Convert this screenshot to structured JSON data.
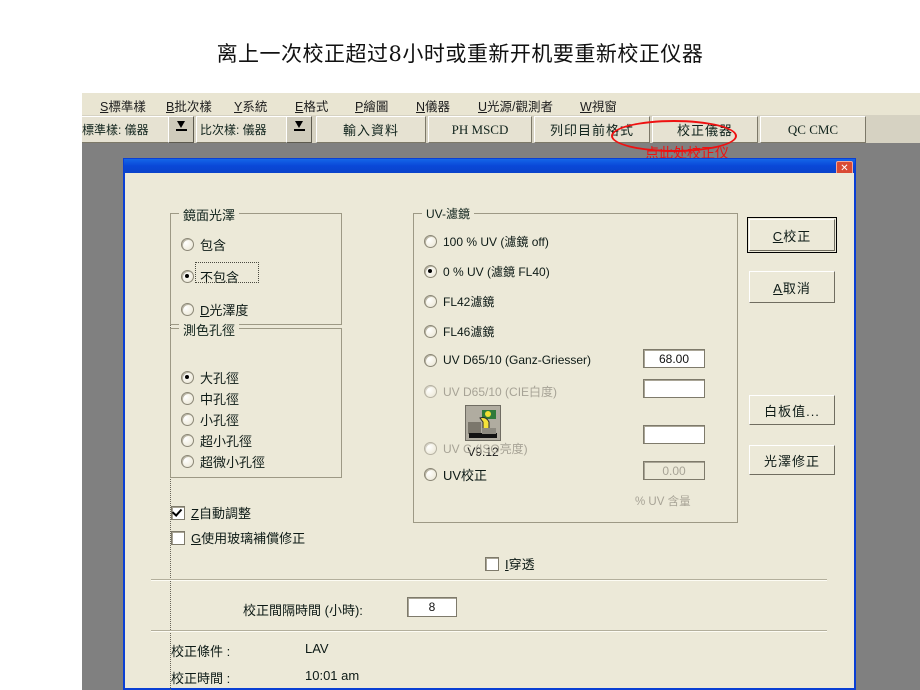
{
  "slide": {
    "heading": "离上一次校正超过8小时或重新开机要重新校正仪器"
  },
  "annotation": {
    "note": "点此处校正仪器",
    "color": "#ee1111"
  },
  "menubar": {
    "items": [
      {
        "mnemonic": "S",
        "label": "標準樣"
      },
      {
        "mnemonic": "B",
        "label": "批次樣"
      },
      {
        "mnemonic": "Y",
        "label": "系統"
      },
      {
        "mnemonic": "E",
        "label": "格式"
      },
      {
        "mnemonic": "P",
        "label": "繪圖"
      },
      {
        "mnemonic": "N",
        "label": "儀器"
      },
      {
        "mnemonic": "U",
        "label": "光源/觀測者"
      },
      {
        "mnemonic": "W",
        "label": "視窗"
      }
    ]
  },
  "toolbar": {
    "standard_combo": "標準樣: 儀器",
    "batch_combo": "比次樣: 儀器",
    "input_data": "輸入資料",
    "ph_mscd": "PH MSCD",
    "print_format": "列印目前格式",
    "calibrate": "校正儀器",
    "qc_cmc": "QC CMC"
  },
  "dialog": {
    "title": "",
    "close_label": "✕",
    "product": {
      "version": "V9.12",
      "icon": "instrument-icon"
    },
    "gloss_group": {
      "title": "鏡面光澤",
      "options": [
        {
          "mnemonic": "",
          "label": "包含",
          "selected": false,
          "enabled": true
        },
        {
          "mnemonic": "",
          "label": "不包含",
          "selected": true,
          "enabled": true,
          "focused": true
        },
        {
          "mnemonic": "D",
          "label": "光澤度",
          "selected": false,
          "enabled": true
        }
      ]
    },
    "aperture_group": {
      "title": "測色孔徑",
      "options": [
        {
          "label": "大孔徑",
          "selected": true
        },
        {
          "label": "中孔徑",
          "selected": false
        },
        {
          "label": "小孔徑",
          "selected": false
        },
        {
          "label": "超小孔徑",
          "selected": false
        },
        {
          "label": "超微小孔徑",
          "selected": false
        }
      ]
    },
    "checkboxes": [
      {
        "mnemonic": "Z",
        "label": "自動調整",
        "checked": true
      },
      {
        "mnemonic": "G",
        "label": "使用玻璃補償修正",
        "checked": false
      }
    ],
    "uv_group": {
      "title": "UV-濾鏡",
      "options": [
        {
          "label": "100 % UV (濾鏡 off)",
          "selected": false,
          "enabled": true,
          "value": null
        },
        {
          "label": "0 % UV (濾鏡 FL40)",
          "selected": true,
          "enabled": true,
          "value": null
        },
        {
          "label": "FL42濾鏡",
          "selected": false,
          "enabled": true,
          "value": null
        },
        {
          "label": "FL46濾鏡",
          "selected": false,
          "enabled": true,
          "value": null
        },
        {
          "label": "UV D65/10 (Ganz-Griesser)",
          "selected": false,
          "enabled": true,
          "value": "68.00",
          "value_enabled": true
        },
        {
          "label": "UV D65/10 (CIE白度)",
          "selected": false,
          "enabled": false,
          "value": "",
          "value_enabled": true
        },
        {
          "label": "UV C (ISO亮度)",
          "selected": false,
          "enabled": false,
          "value": "",
          "value_enabled": true
        },
        {
          "label": "UV校正",
          "selected": false,
          "enabled": true,
          "value": "0.00",
          "value_enabled": false
        }
      ],
      "unit_label": "% UV 含量"
    },
    "transmission": {
      "mnemonic": "I",
      "label": "穿透",
      "checked": false
    },
    "interval": {
      "label": "校正間隔時間 (小時):",
      "value": "8"
    },
    "status": [
      {
        "label": "校正條件 :",
        "value": "LAV"
      },
      {
        "label": "校正時間 :",
        "value": "10:01 am"
      }
    ],
    "buttons": {
      "calibrate": {
        "mnemonic": "C",
        "label": "校正"
      },
      "cancel": {
        "mnemonic": "A",
        "label": "取消"
      },
      "white_tile": "白板值...",
      "gloss_correct": "光澤修正"
    }
  }
}
